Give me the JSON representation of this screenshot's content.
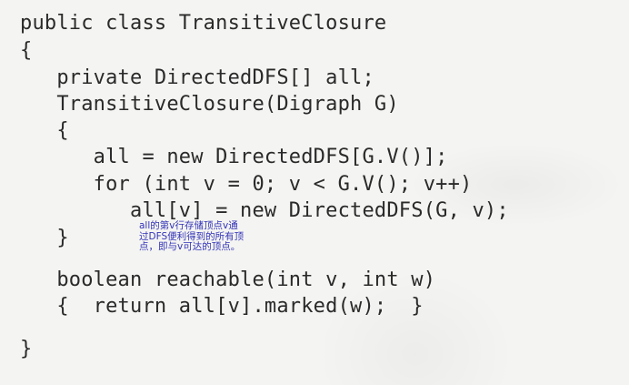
{
  "code": {
    "lines": [
      "public class TransitiveClosure",
      "{",
      "   private DirectedDFS[] all;",
      "   TransitiveClosure(Digraph G)",
      "   {",
      "      all = new DirectedDFS[G.V()];",
      "      for (int v = 0; v < G.V(); v++)",
      "         all[v] = new DirectedDFS(G, v);",
      "   }",
      "   boolean reachable(int v, int w)",
      "   {  return all[v].marked(w);  }",
      "}"
    ]
  },
  "annotation": {
    "text": "all的第v行存储顶点v通\n过DFS便利得到的所有顶\n点，即与v可达的顶点。"
  },
  "colors": {
    "background": "#f4f4f2",
    "code_text": "#2a2a2a",
    "annotation_text": "#3333b8"
  }
}
